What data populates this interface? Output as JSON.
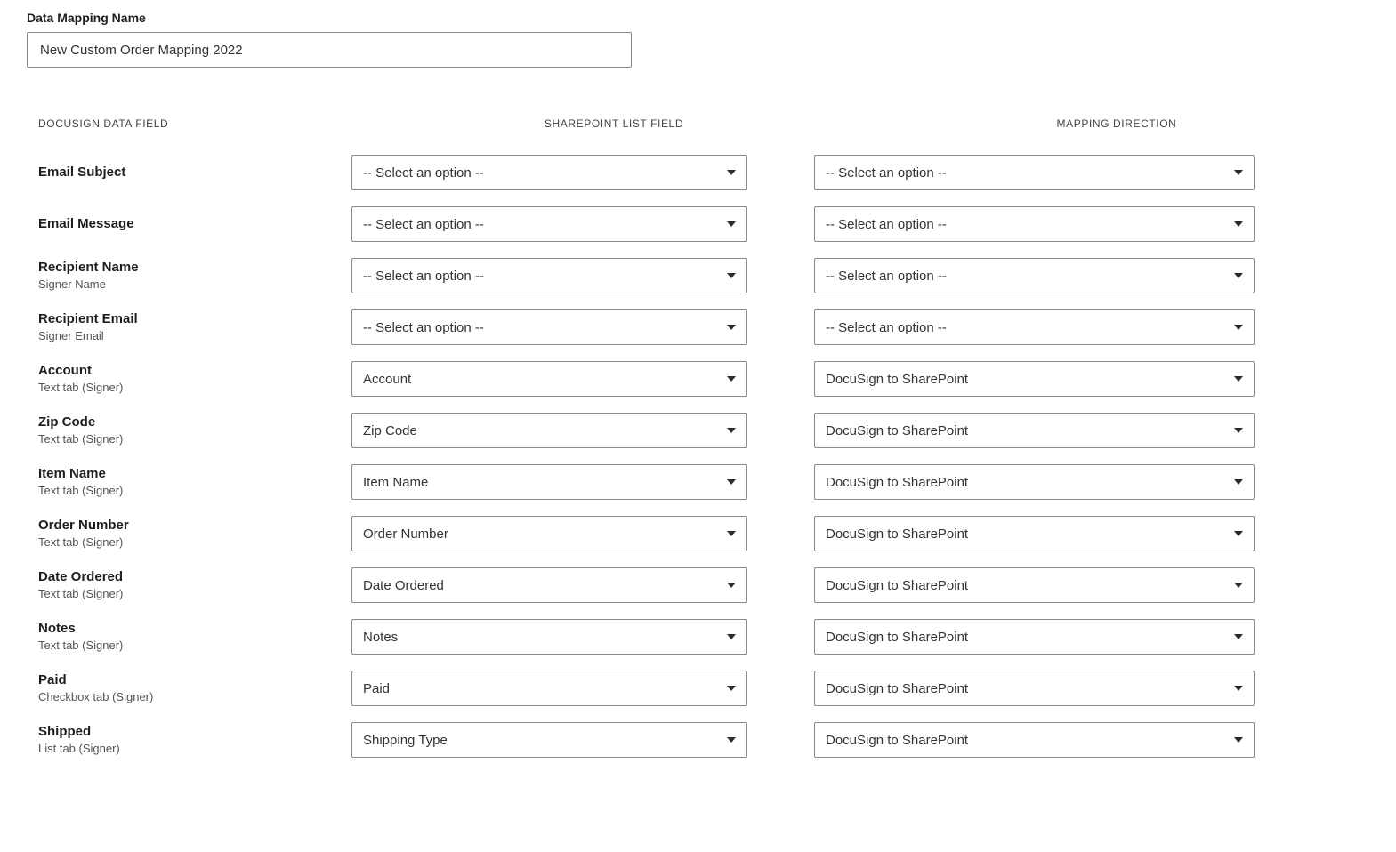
{
  "topLabel": "Data Mapping Name",
  "mappingName": "New Custom Order Mapping 2022",
  "headers": {
    "docusign": "DOCUSIGN DATA FIELD",
    "sharepoint": "SHAREPOINT LIST FIELD",
    "direction": "MAPPING DIRECTION"
  },
  "placeholderOption": "-- Select an option --",
  "directionValue": "DocuSign to SharePoint",
  "rows": [
    {
      "name": "Email Subject",
      "sub": "",
      "listVal": "-- Select an option --",
      "dirVal": "-- Select an option --"
    },
    {
      "name": "Email Message",
      "sub": "",
      "listVal": "-- Select an option --",
      "dirVal": "-- Select an option --"
    },
    {
      "name": "Recipient Name",
      "sub": "Signer Name",
      "listVal": "-- Select an option --",
      "dirVal": "-- Select an option --"
    },
    {
      "name": "Recipient Email",
      "sub": "Signer Email",
      "listVal": "-- Select an option --",
      "dirVal": "-- Select an option --"
    },
    {
      "name": "Account",
      "sub": "Text tab (Signer)",
      "listVal": "Account",
      "dirVal": "DocuSign to SharePoint"
    },
    {
      "name": "Zip Code",
      "sub": "Text tab (Signer)",
      "listVal": "Zip Code",
      "dirVal": "DocuSign to SharePoint"
    },
    {
      "name": "Item Name",
      "sub": "Text tab (Signer)",
      "listVal": "Item Name",
      "dirVal": "DocuSign to SharePoint"
    },
    {
      "name": "Order Number",
      "sub": "Text tab (Signer)",
      "listVal": "Order Number",
      "dirVal": "DocuSign to SharePoint"
    },
    {
      "name": "Date Ordered",
      "sub": "Text tab (Signer)",
      "listVal": "Date Ordered",
      "dirVal": "DocuSign to SharePoint"
    },
    {
      "name": "Notes",
      "sub": "Text tab (Signer)",
      "listVal": "Notes",
      "dirVal": "DocuSign to SharePoint"
    },
    {
      "name": "Paid",
      "sub": "Checkbox tab (Signer)",
      "listVal": "Paid",
      "dirVal": "DocuSign to SharePoint"
    },
    {
      "name": "Shipped",
      "sub": "List tab (Signer)",
      "listVal": "Shipping Type",
      "dirVal": "DocuSign to SharePoint"
    }
  ]
}
